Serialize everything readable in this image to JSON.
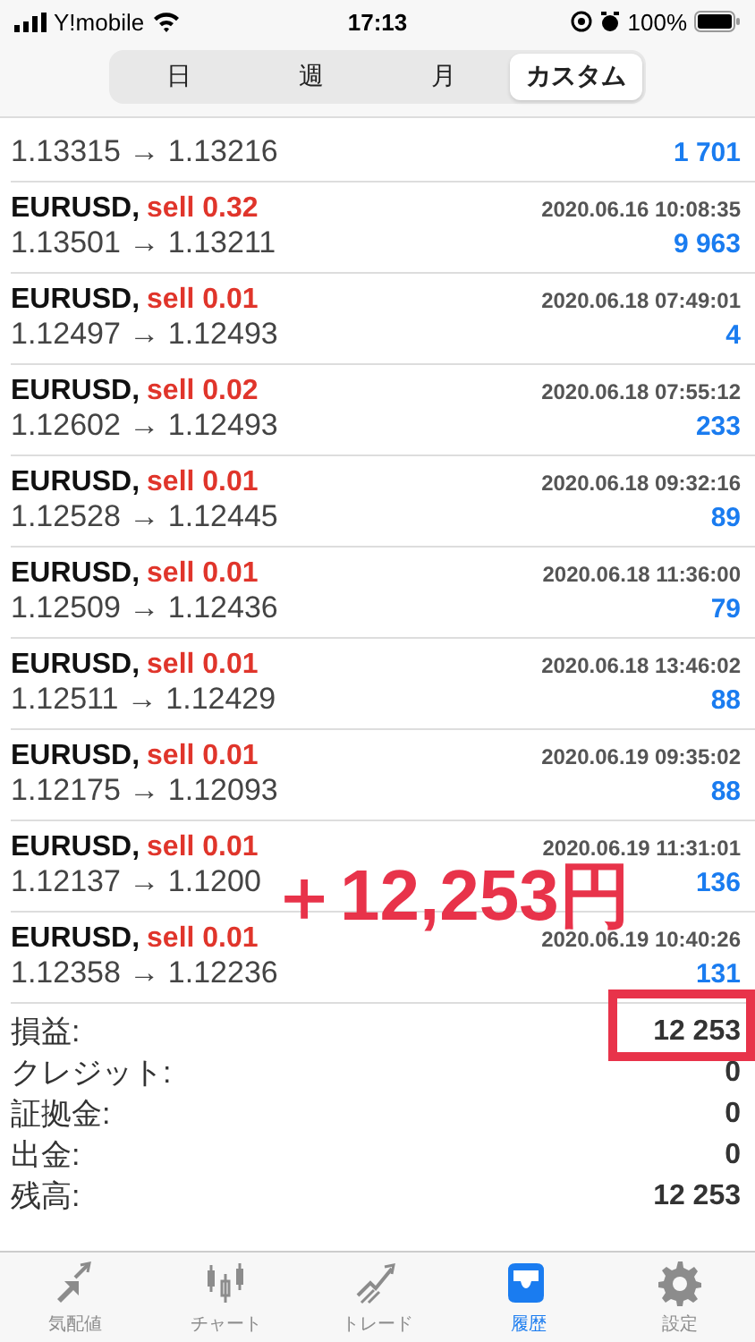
{
  "status_bar": {
    "carrier": "Y!mobile",
    "time": "17:13",
    "battery": "100%"
  },
  "period_tabs": [
    {
      "label": "日",
      "selected": false
    },
    {
      "label": "週",
      "selected": false
    },
    {
      "label": "月",
      "selected": false
    },
    {
      "label": "カスタム",
      "selected": true
    }
  ],
  "partial_row": {
    "prices": "1.13315 → 1.13216",
    "profit": "1 701"
  },
  "deals": [
    {
      "symbol": "EURUSD,",
      "action": "sell 0.32",
      "time": "2020.06.16 10:08:35",
      "prices": "1.13501 → 1.13211",
      "profit": "9 963"
    },
    {
      "symbol": "EURUSD,",
      "action": "sell 0.01",
      "time": "2020.06.18 07:49:01",
      "prices": "1.12497 → 1.12493",
      "profit": "4"
    },
    {
      "symbol": "EURUSD,",
      "action": "sell 0.02",
      "time": "2020.06.18 07:55:12",
      "prices": "1.12602 → 1.12493",
      "profit": "233"
    },
    {
      "symbol": "EURUSD,",
      "action": "sell 0.01",
      "time": "2020.06.18 09:32:16",
      "prices": "1.12528 → 1.12445",
      "profit": "89"
    },
    {
      "symbol": "EURUSD,",
      "action": "sell 0.01",
      "time": "2020.06.18 11:36:00",
      "prices": "1.12509 → 1.12436",
      "profit": "79"
    },
    {
      "symbol": "EURUSD,",
      "action": "sell 0.01",
      "time": "2020.06.18 13:46:02",
      "prices": "1.12511 → 1.12429",
      "profit": "88"
    },
    {
      "symbol": "EURUSD,",
      "action": "sell 0.01",
      "time": "2020.06.19 09:35:02",
      "prices": "1.12175 → 1.12093",
      "profit": "88"
    },
    {
      "symbol": "EURUSD,",
      "action": "sell 0.01",
      "time": "2020.06.19 11:31:01",
      "prices": "1.12137 → 1.1200",
      "profit": "136"
    },
    {
      "symbol": "EURUSD,",
      "action": "sell 0.01",
      "time": "2020.06.19 10:40:26",
      "prices": "1.12358 → 1.12236",
      "profit": "131"
    }
  ],
  "summary": [
    {
      "label": "損益:",
      "value": "12 253"
    },
    {
      "label": "クレジット:",
      "value": "0"
    },
    {
      "label": "証拠金:",
      "value": "0"
    },
    {
      "label": "出金:",
      "value": "0"
    },
    {
      "label": "残高:",
      "value": "12 253"
    }
  ],
  "annotation": {
    "text": "＋12,253円"
  },
  "tab_bar": [
    {
      "kind": "quotes",
      "label": "気配値",
      "selected": false
    },
    {
      "kind": "chart",
      "label": "チャート",
      "selected": false
    },
    {
      "kind": "trade",
      "label": "トレード",
      "selected": false
    },
    {
      "kind": "history",
      "label": "履歴",
      "selected": true
    },
    {
      "kind": "settings",
      "label": "設定",
      "selected": false
    }
  ]
}
